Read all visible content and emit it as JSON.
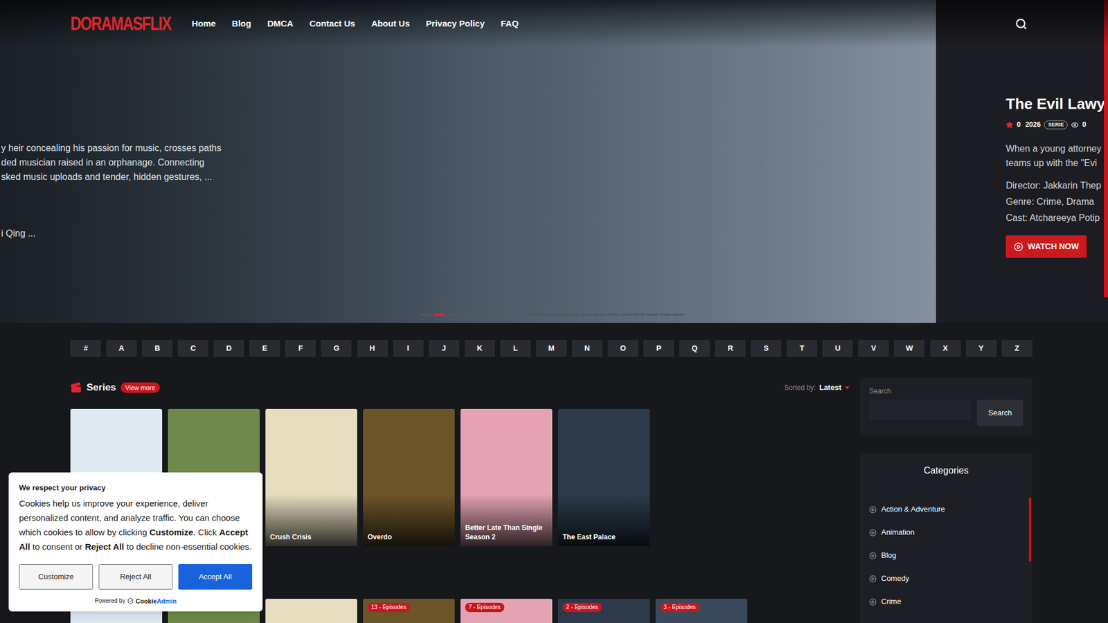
{
  "header": {
    "logo": "DORAMASFLIX",
    "nav": [
      "Home",
      "Blog",
      "DMCA",
      "Contact Us",
      "About Us",
      "Privacy Policy",
      "FAQ"
    ]
  },
  "hero": {
    "previous_slide": {
      "lines": [
        "y heir concealing his passion for music, crosses paths",
        "ded musician raised in an orphanage. Connecting",
        "sked music uploads and tender, hidden gestures, ..."
      ],
      "cast_line": "i Qing ..."
    },
    "current_slide": {
      "title": "The Evil Lawy",
      "rating": "0",
      "year": "2026",
      "type": "SERIE",
      "views": "0",
      "description_lines": [
        "When a young attorney",
        "teams up with the \"Evi"
      ],
      "director": "Director: Jakkarin Thep",
      "genre": "Genre: Crime, Drama",
      "cast": "Cast: Atchareeya Potip",
      "button": "WATCH NOW"
    },
    "dots": [
      {
        "selected": false
      },
      {
        "selected": true
      },
      {
        "selected": false
      },
      {
        "selected": false
      },
      {
        "selected": false
      },
      {
        "selected": false
      },
      {
        "selected": false
      },
      {
        "selected": false
      },
      {
        "selected": false
      },
      {
        "selected": false
      },
      {
        "selected": false
      },
      {
        "selected": false
      },
      {
        "selected": false
      },
      {
        "selected": false
      },
      {
        "selected": false
      },
      {
        "selected": false
      },
      {
        "selected": false
      },
      {
        "selected": false
      },
      {
        "selected": false
      },
      {
        "selected": false
      }
    ]
  },
  "alphabet": [
    "#",
    "A",
    "B",
    "C",
    "D",
    "E",
    "F",
    "G",
    "H",
    "I",
    "J",
    "K",
    "L",
    "M",
    "N",
    "O",
    "P",
    "Q",
    "R",
    "S",
    "T",
    "U",
    "V",
    "W",
    "X",
    "Y",
    "Z"
  ],
  "series": {
    "title": "Series",
    "view_more": "View more",
    "sort_label": "Sorted by:",
    "sort_value": "Latest",
    "cards": [
      {
        "color": "#dfe9f2"
      },
      {
        "color": "#6f8a4a"
      },
      {
        "title": "Crush Crisis",
        "color": "#e6dcc0"
      },
      {
        "title": "Overdo",
        "color": "#6b5428"
      },
      {
        "title": "Better Late Than Single Season 2",
        "color": "#e3a3b4"
      },
      {
        "title": "The East Palace",
        "color": "#2c3a4a"
      }
    ]
  },
  "episodes_row": [
    {
      "color": "#dfe9f2"
    },
    {
      "color": "#6f8a4a"
    },
    {
      "color": "#e6dcc0"
    },
    {
      "badge": "13 - Episodes",
      "color": "#6b5428"
    },
    {
      "badge": "7 - Episodes",
      "color": "#e3a3b4"
    },
    {
      "badge": "2 - Episodes",
      "color": "#2c3a4a"
    },
    {
      "badge": "3 - Episodes",
      "color": "#3a4a5c"
    }
  ],
  "sidebar": {
    "search": {
      "label": "Search",
      "button": "Search"
    },
    "categories": {
      "title": "Categories",
      "items": [
        "Action & Adventure",
        "Animation",
        "Blog",
        "Comedy",
        "Crime"
      ]
    }
  },
  "cookie_banner": {
    "title": "We respect your privacy",
    "body": [
      {
        "text": "Cookies help us improve your experience, deliver personalized content, and analyze traffic. You can choose which cookies to allow by clicking ",
        "bold": false
      },
      {
        "text": "Customize",
        "bold": true
      },
      {
        "text": ". Click ",
        "bold": false
      },
      {
        "text": "Accept All",
        "bold": true
      },
      {
        "text": " to consent or ",
        "bold": false
      },
      {
        "text": "Reject All",
        "bold": true
      },
      {
        "text": " to decline non-essential cookies.",
        "bold": false
      }
    ],
    "buttons": [
      {
        "label": "Customize",
        "kind": "secondary"
      },
      {
        "label": "Reject All",
        "kind": "secondary"
      },
      {
        "label": "Accept All",
        "kind": "primary"
      }
    ],
    "powered_by": "Powered by",
    "brand": [
      "Cookie",
      "Admin"
    ]
  }
}
